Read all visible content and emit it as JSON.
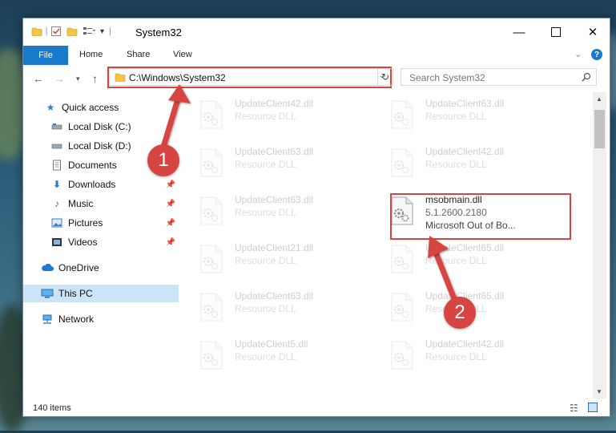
{
  "window": {
    "title": "System32"
  },
  "ribbon": {
    "file_tab": "File",
    "tabs": [
      "Home",
      "Share",
      "View"
    ]
  },
  "address": {
    "path": "C:\\Windows\\System32",
    "search_placeholder": "Search System32"
  },
  "sidebar": {
    "items": [
      {
        "label": "Quick access",
        "icon": "star-icon"
      },
      {
        "label": "Local Disk (C:)",
        "icon": "drive-icon"
      },
      {
        "label": "Local Disk (D:)",
        "icon": "drive-icon"
      },
      {
        "label": "Documents",
        "icon": "document-icon"
      },
      {
        "label": "Downloads",
        "icon": "download-icon"
      },
      {
        "label": "Music",
        "icon": "music-icon"
      },
      {
        "label": "Pictures",
        "icon": "picture-icon"
      },
      {
        "label": "Videos",
        "icon": "video-icon"
      },
      {
        "label": "OneDrive",
        "icon": "cloud-icon"
      },
      {
        "label": "This PC",
        "icon": "computer-icon"
      },
      {
        "label": "Network",
        "icon": "network-icon"
      }
    ]
  },
  "files": [
    {
      "name": "UpdateClient42.dll",
      "type": "Resource DLL"
    },
    {
      "name": "UpdateClient63.dll",
      "type": "Resource DLL"
    },
    {
      "name": "UpdateClient63.dll",
      "type": "Resource DLL"
    },
    {
      "name": "UpdateClient42.dll",
      "type": "Resource DLL"
    },
    {
      "name": "UpdateClient63.dll",
      "type": "Resource DLL"
    },
    {
      "name": "msobmain.dll",
      "type": "5.1.2600.2180",
      "desc": "Microsoft Out of Bo..."
    },
    {
      "name": "UpdateClient21.dll",
      "type": "Resource DLL"
    },
    {
      "name": "UpdateClient65.dll",
      "type": "Resource DLL"
    },
    {
      "name": "UpdateClient63.dll",
      "type": "Resource DLL"
    },
    {
      "name": "UpdateClient65.dll",
      "type": "Resource DLL"
    },
    {
      "name": "UpdateClient5.dll",
      "type": "Resource DLL"
    },
    {
      "name": "UpdateClient42.dll",
      "type": "Resource DLL"
    }
  ],
  "status": {
    "count": "140 items"
  },
  "annotations": {
    "step1": "1",
    "step2": "2"
  },
  "colors": {
    "accent": "#1979ca",
    "highlight": "#d64541",
    "selected": "#cce4f7"
  }
}
